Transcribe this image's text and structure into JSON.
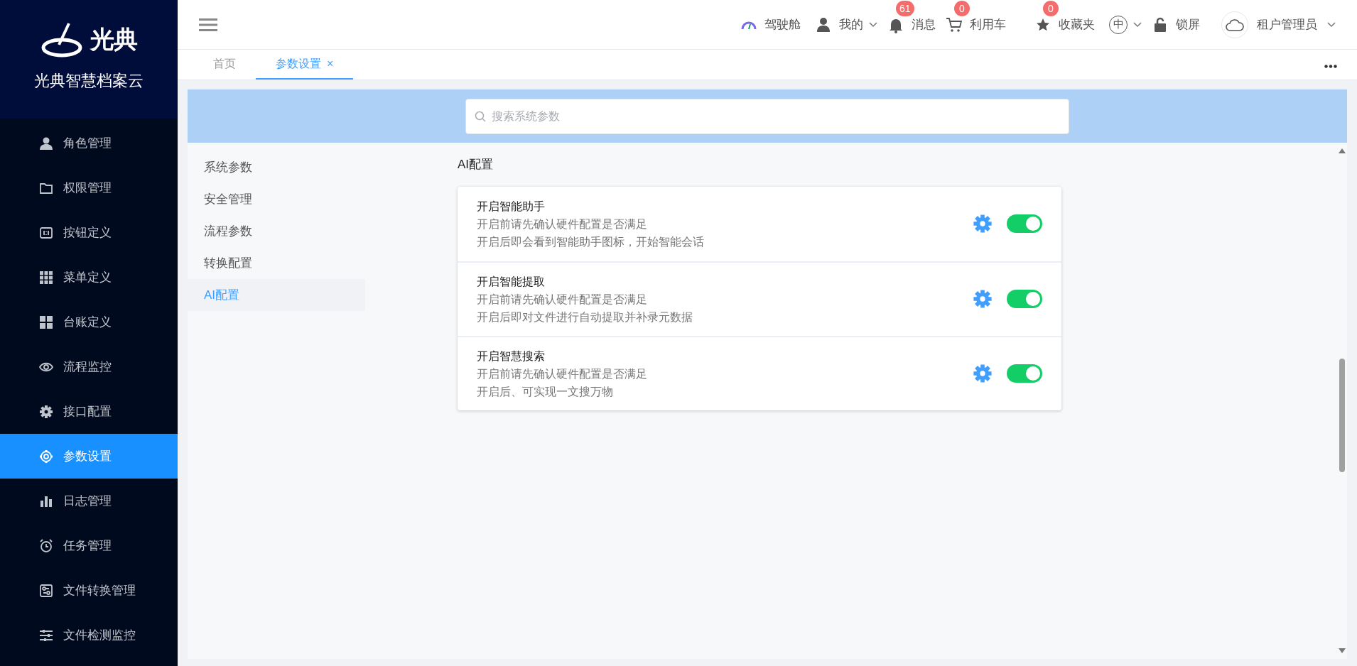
{
  "brand": {
    "logo_text": "光典",
    "title": "光典智慧档案云"
  },
  "sidebar": {
    "items": [
      {
        "label": "角色管理",
        "selected": false
      },
      {
        "label": "权限管理",
        "selected": false
      },
      {
        "label": "按钮定义",
        "selected": false
      },
      {
        "label": "菜单定义",
        "selected": false
      },
      {
        "label": "台账定义",
        "selected": false
      },
      {
        "label": "流程监控",
        "selected": false
      },
      {
        "label": "接口配置",
        "selected": false
      },
      {
        "label": "参数设置",
        "selected": true
      },
      {
        "label": "日志管理",
        "selected": false
      },
      {
        "label": "任务管理",
        "selected": false
      },
      {
        "label": "文件转换管理",
        "selected": false
      },
      {
        "label": "文件检测监控",
        "selected": false
      }
    ]
  },
  "header": {
    "cockpit": "驾驶舱",
    "mine": "我的",
    "messages": {
      "label": "消息",
      "badge": "61"
    },
    "cart": {
      "label": "利用车",
      "badge": "0"
    },
    "favorites": {
      "label": "收藏夹",
      "badge": "0"
    },
    "language": "中",
    "lock": "锁屏",
    "user": "租户管理员"
  },
  "tabs": [
    {
      "label": "首页",
      "selected": false
    },
    {
      "label": "参数设置",
      "selected": true,
      "close": "×"
    }
  ],
  "search": {
    "placeholder": "搜索系统参数"
  },
  "categories": [
    {
      "label": "系统参数",
      "selected": false
    },
    {
      "label": "安全管理",
      "selected": false
    },
    {
      "label": "流程参数",
      "selected": false
    },
    {
      "label": "转换配置",
      "selected": false
    },
    {
      "label": "AI配置",
      "selected": true
    }
  ],
  "section": {
    "title": "AI配置",
    "settings": [
      {
        "title": "开启智能助手",
        "lines": [
          "开启前请先确认硬件配置是否满足",
          "开启后即会看到智能助手图标，开始智能会话"
        ],
        "on": true
      },
      {
        "title": "开启智能提取",
        "lines": [
          "开启前请先确认硬件配置是否满足",
          "开启后即对文件进行自动提取并补录元数据"
        ],
        "on": true
      },
      {
        "title": "开启智慧搜索",
        "lines": [
          "开启前请先确认硬件配置是否满足",
          "开启后、可实现一文搜万物"
        ],
        "on": true
      }
    ]
  }
}
